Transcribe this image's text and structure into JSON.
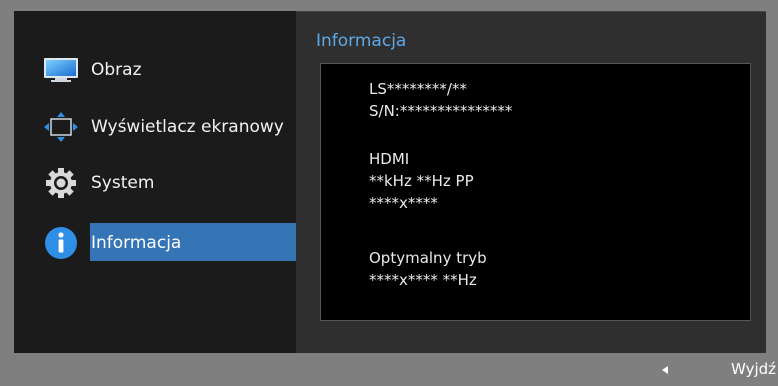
{
  "menu": {
    "items": [
      {
        "label": "Obraz",
        "icon": "monitor-icon"
      },
      {
        "label": "Wyświetlacz ekranowy",
        "icon": "move-arrows-icon"
      },
      {
        "label": "System",
        "icon": "gear-icon"
      },
      {
        "label": "Informacja",
        "icon": "info-icon",
        "selected": true
      }
    ]
  },
  "panel": {
    "title": "Informacja",
    "lines": [
      "LS********/**",
      "S/N:***************",
      "HDMI",
      "**kHz **Hz PP",
      "****x****",
      "Optymalny tryb",
      "****x**** **Hz"
    ]
  },
  "footer": {
    "back_icon": "left-arrow-icon",
    "exit_label": "Wyjdź"
  },
  "colors": {
    "accent": "#3574b5",
    "title": "#5ea8e6",
    "background": "#7f7f7f"
  }
}
